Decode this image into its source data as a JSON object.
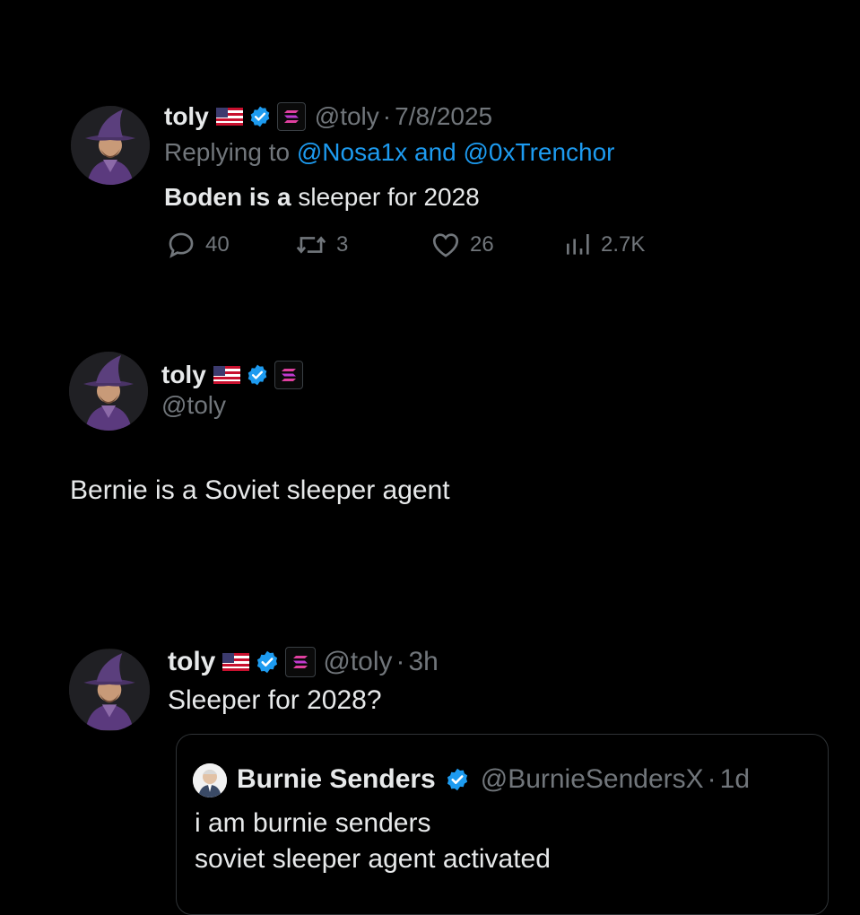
{
  "colors": {
    "background": "#000000",
    "text": "#e7e9ea",
    "muted": "#71767b",
    "link": "#1d9bf0",
    "verified": "#1d9bf0"
  },
  "post1": {
    "author": "toly",
    "handle": "@toly",
    "sep": "·",
    "date": "7/8/2025",
    "replying_prefix": "Replying to",
    "replying_to": "@Nosa1x and @0xTrenchor",
    "text_bold": "Boden is a",
    "text_rest": "sleeper for 2028",
    "actions": {
      "replies": "40",
      "reposts": "3",
      "likes": "26",
      "views": "2.7K"
    },
    "icons": [
      "flag-us-icon",
      "verified-icon",
      "solana-badge-icon",
      "reply-icon",
      "repost-icon",
      "like-icon",
      "views-icon"
    ]
  },
  "post2": {
    "author": "toly",
    "handle": "@toly",
    "text": "Bernie is a Soviet sleeper agent"
  },
  "post3": {
    "author": "toly",
    "handle": "@toly",
    "sep": "·",
    "time": "3h",
    "text": "Sleeper for 2028?",
    "quote": {
      "author": "Burnie Senders",
      "handle": "@BurnieSendersX",
      "sep": "·",
      "time": "1d",
      "line1": "i am burnie senders",
      "line2": "soviet sleeper agent activated"
    }
  }
}
